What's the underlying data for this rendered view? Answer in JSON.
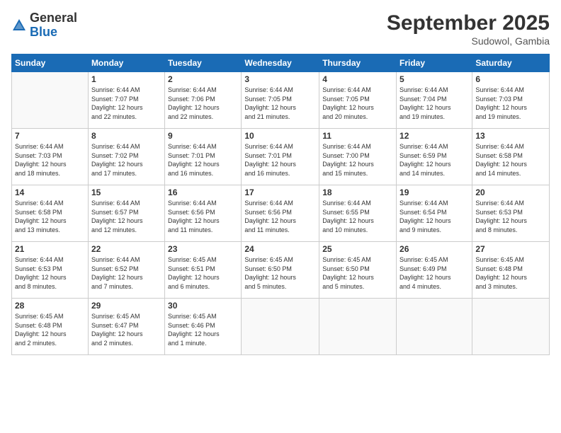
{
  "header": {
    "logo_general": "General",
    "logo_blue": "Blue",
    "month": "September 2025",
    "location": "Sudowol, Gambia"
  },
  "days_of_week": [
    "Sunday",
    "Monday",
    "Tuesday",
    "Wednesday",
    "Thursday",
    "Friday",
    "Saturday"
  ],
  "weeks": [
    [
      {
        "day": "",
        "info": ""
      },
      {
        "day": "1",
        "info": "Sunrise: 6:44 AM\nSunset: 7:07 PM\nDaylight: 12 hours\nand 22 minutes."
      },
      {
        "day": "2",
        "info": "Sunrise: 6:44 AM\nSunset: 7:06 PM\nDaylight: 12 hours\nand 22 minutes."
      },
      {
        "day": "3",
        "info": "Sunrise: 6:44 AM\nSunset: 7:05 PM\nDaylight: 12 hours\nand 21 minutes."
      },
      {
        "day": "4",
        "info": "Sunrise: 6:44 AM\nSunset: 7:05 PM\nDaylight: 12 hours\nand 20 minutes."
      },
      {
        "day": "5",
        "info": "Sunrise: 6:44 AM\nSunset: 7:04 PM\nDaylight: 12 hours\nand 19 minutes."
      },
      {
        "day": "6",
        "info": "Sunrise: 6:44 AM\nSunset: 7:03 PM\nDaylight: 12 hours\nand 19 minutes."
      }
    ],
    [
      {
        "day": "7",
        "info": "Sunrise: 6:44 AM\nSunset: 7:03 PM\nDaylight: 12 hours\nand 18 minutes."
      },
      {
        "day": "8",
        "info": "Sunrise: 6:44 AM\nSunset: 7:02 PM\nDaylight: 12 hours\nand 17 minutes."
      },
      {
        "day": "9",
        "info": "Sunrise: 6:44 AM\nSunset: 7:01 PM\nDaylight: 12 hours\nand 16 minutes."
      },
      {
        "day": "10",
        "info": "Sunrise: 6:44 AM\nSunset: 7:01 PM\nDaylight: 12 hours\nand 16 minutes."
      },
      {
        "day": "11",
        "info": "Sunrise: 6:44 AM\nSunset: 7:00 PM\nDaylight: 12 hours\nand 15 minutes."
      },
      {
        "day": "12",
        "info": "Sunrise: 6:44 AM\nSunset: 6:59 PM\nDaylight: 12 hours\nand 14 minutes."
      },
      {
        "day": "13",
        "info": "Sunrise: 6:44 AM\nSunset: 6:58 PM\nDaylight: 12 hours\nand 14 minutes."
      }
    ],
    [
      {
        "day": "14",
        "info": "Sunrise: 6:44 AM\nSunset: 6:58 PM\nDaylight: 12 hours\nand 13 minutes."
      },
      {
        "day": "15",
        "info": "Sunrise: 6:44 AM\nSunset: 6:57 PM\nDaylight: 12 hours\nand 12 minutes."
      },
      {
        "day": "16",
        "info": "Sunrise: 6:44 AM\nSunset: 6:56 PM\nDaylight: 12 hours\nand 11 minutes."
      },
      {
        "day": "17",
        "info": "Sunrise: 6:44 AM\nSunset: 6:56 PM\nDaylight: 12 hours\nand 11 minutes."
      },
      {
        "day": "18",
        "info": "Sunrise: 6:44 AM\nSunset: 6:55 PM\nDaylight: 12 hours\nand 10 minutes."
      },
      {
        "day": "19",
        "info": "Sunrise: 6:44 AM\nSunset: 6:54 PM\nDaylight: 12 hours\nand 9 minutes."
      },
      {
        "day": "20",
        "info": "Sunrise: 6:44 AM\nSunset: 6:53 PM\nDaylight: 12 hours\nand 8 minutes."
      }
    ],
    [
      {
        "day": "21",
        "info": "Sunrise: 6:44 AM\nSunset: 6:53 PM\nDaylight: 12 hours\nand 8 minutes."
      },
      {
        "day": "22",
        "info": "Sunrise: 6:44 AM\nSunset: 6:52 PM\nDaylight: 12 hours\nand 7 minutes."
      },
      {
        "day": "23",
        "info": "Sunrise: 6:45 AM\nSunset: 6:51 PM\nDaylight: 12 hours\nand 6 minutes."
      },
      {
        "day": "24",
        "info": "Sunrise: 6:45 AM\nSunset: 6:50 PM\nDaylight: 12 hours\nand 5 minutes."
      },
      {
        "day": "25",
        "info": "Sunrise: 6:45 AM\nSunset: 6:50 PM\nDaylight: 12 hours\nand 5 minutes."
      },
      {
        "day": "26",
        "info": "Sunrise: 6:45 AM\nSunset: 6:49 PM\nDaylight: 12 hours\nand 4 minutes."
      },
      {
        "day": "27",
        "info": "Sunrise: 6:45 AM\nSunset: 6:48 PM\nDaylight: 12 hours\nand 3 minutes."
      }
    ],
    [
      {
        "day": "28",
        "info": "Sunrise: 6:45 AM\nSunset: 6:48 PM\nDaylight: 12 hours\nand 2 minutes."
      },
      {
        "day": "29",
        "info": "Sunrise: 6:45 AM\nSunset: 6:47 PM\nDaylight: 12 hours\nand 2 minutes."
      },
      {
        "day": "30",
        "info": "Sunrise: 6:45 AM\nSunset: 6:46 PM\nDaylight: 12 hours\nand 1 minute."
      },
      {
        "day": "",
        "info": ""
      },
      {
        "day": "",
        "info": ""
      },
      {
        "day": "",
        "info": ""
      },
      {
        "day": "",
        "info": ""
      }
    ]
  ]
}
